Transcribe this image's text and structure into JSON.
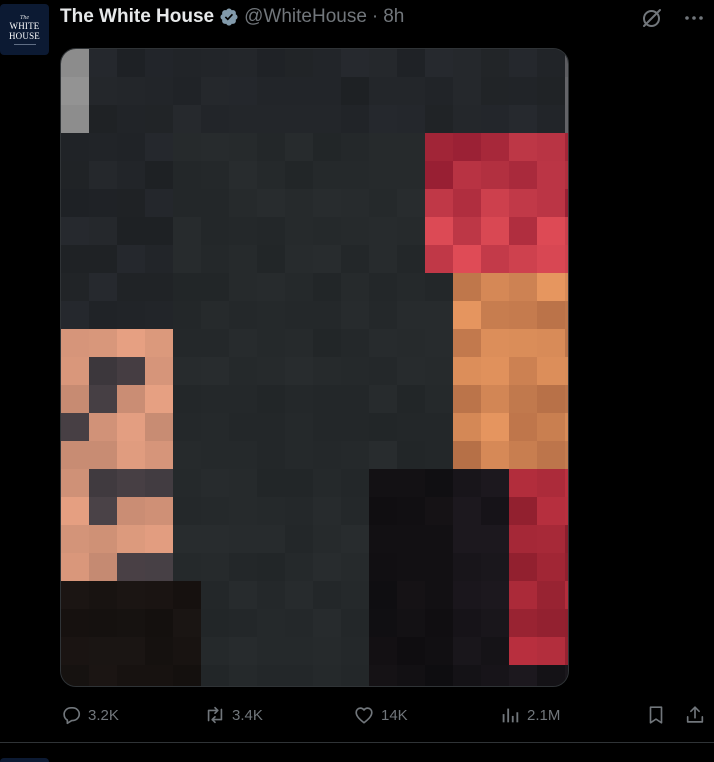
{
  "post": {
    "author_name": "The White House",
    "handle": "@WhiteHouse",
    "separator": "·",
    "time": "8h",
    "avatar_small": "The",
    "avatar_line1": "WHITE",
    "avatar_line2": "HOUSE",
    "verified": true,
    "icons": [
      "verified-badge-icon",
      "grok-icon",
      "more-icon"
    ]
  },
  "media": {
    "kind": "pixelated-photo"
  },
  "actions": {
    "replies": "3.2K",
    "reposts": "3.4K",
    "likes": "14K",
    "views": "2.1M",
    "icons": [
      "reply-icon",
      "repost-icon",
      "like-icon",
      "views-icon",
      "bookmark-icon",
      "share-icon"
    ]
  },
  "colors": {
    "background": "#000000",
    "text": "#e7e9ea",
    "muted": "#71767b",
    "verified": "#829aab",
    "avatar_bg": "#0c1a33"
  }
}
